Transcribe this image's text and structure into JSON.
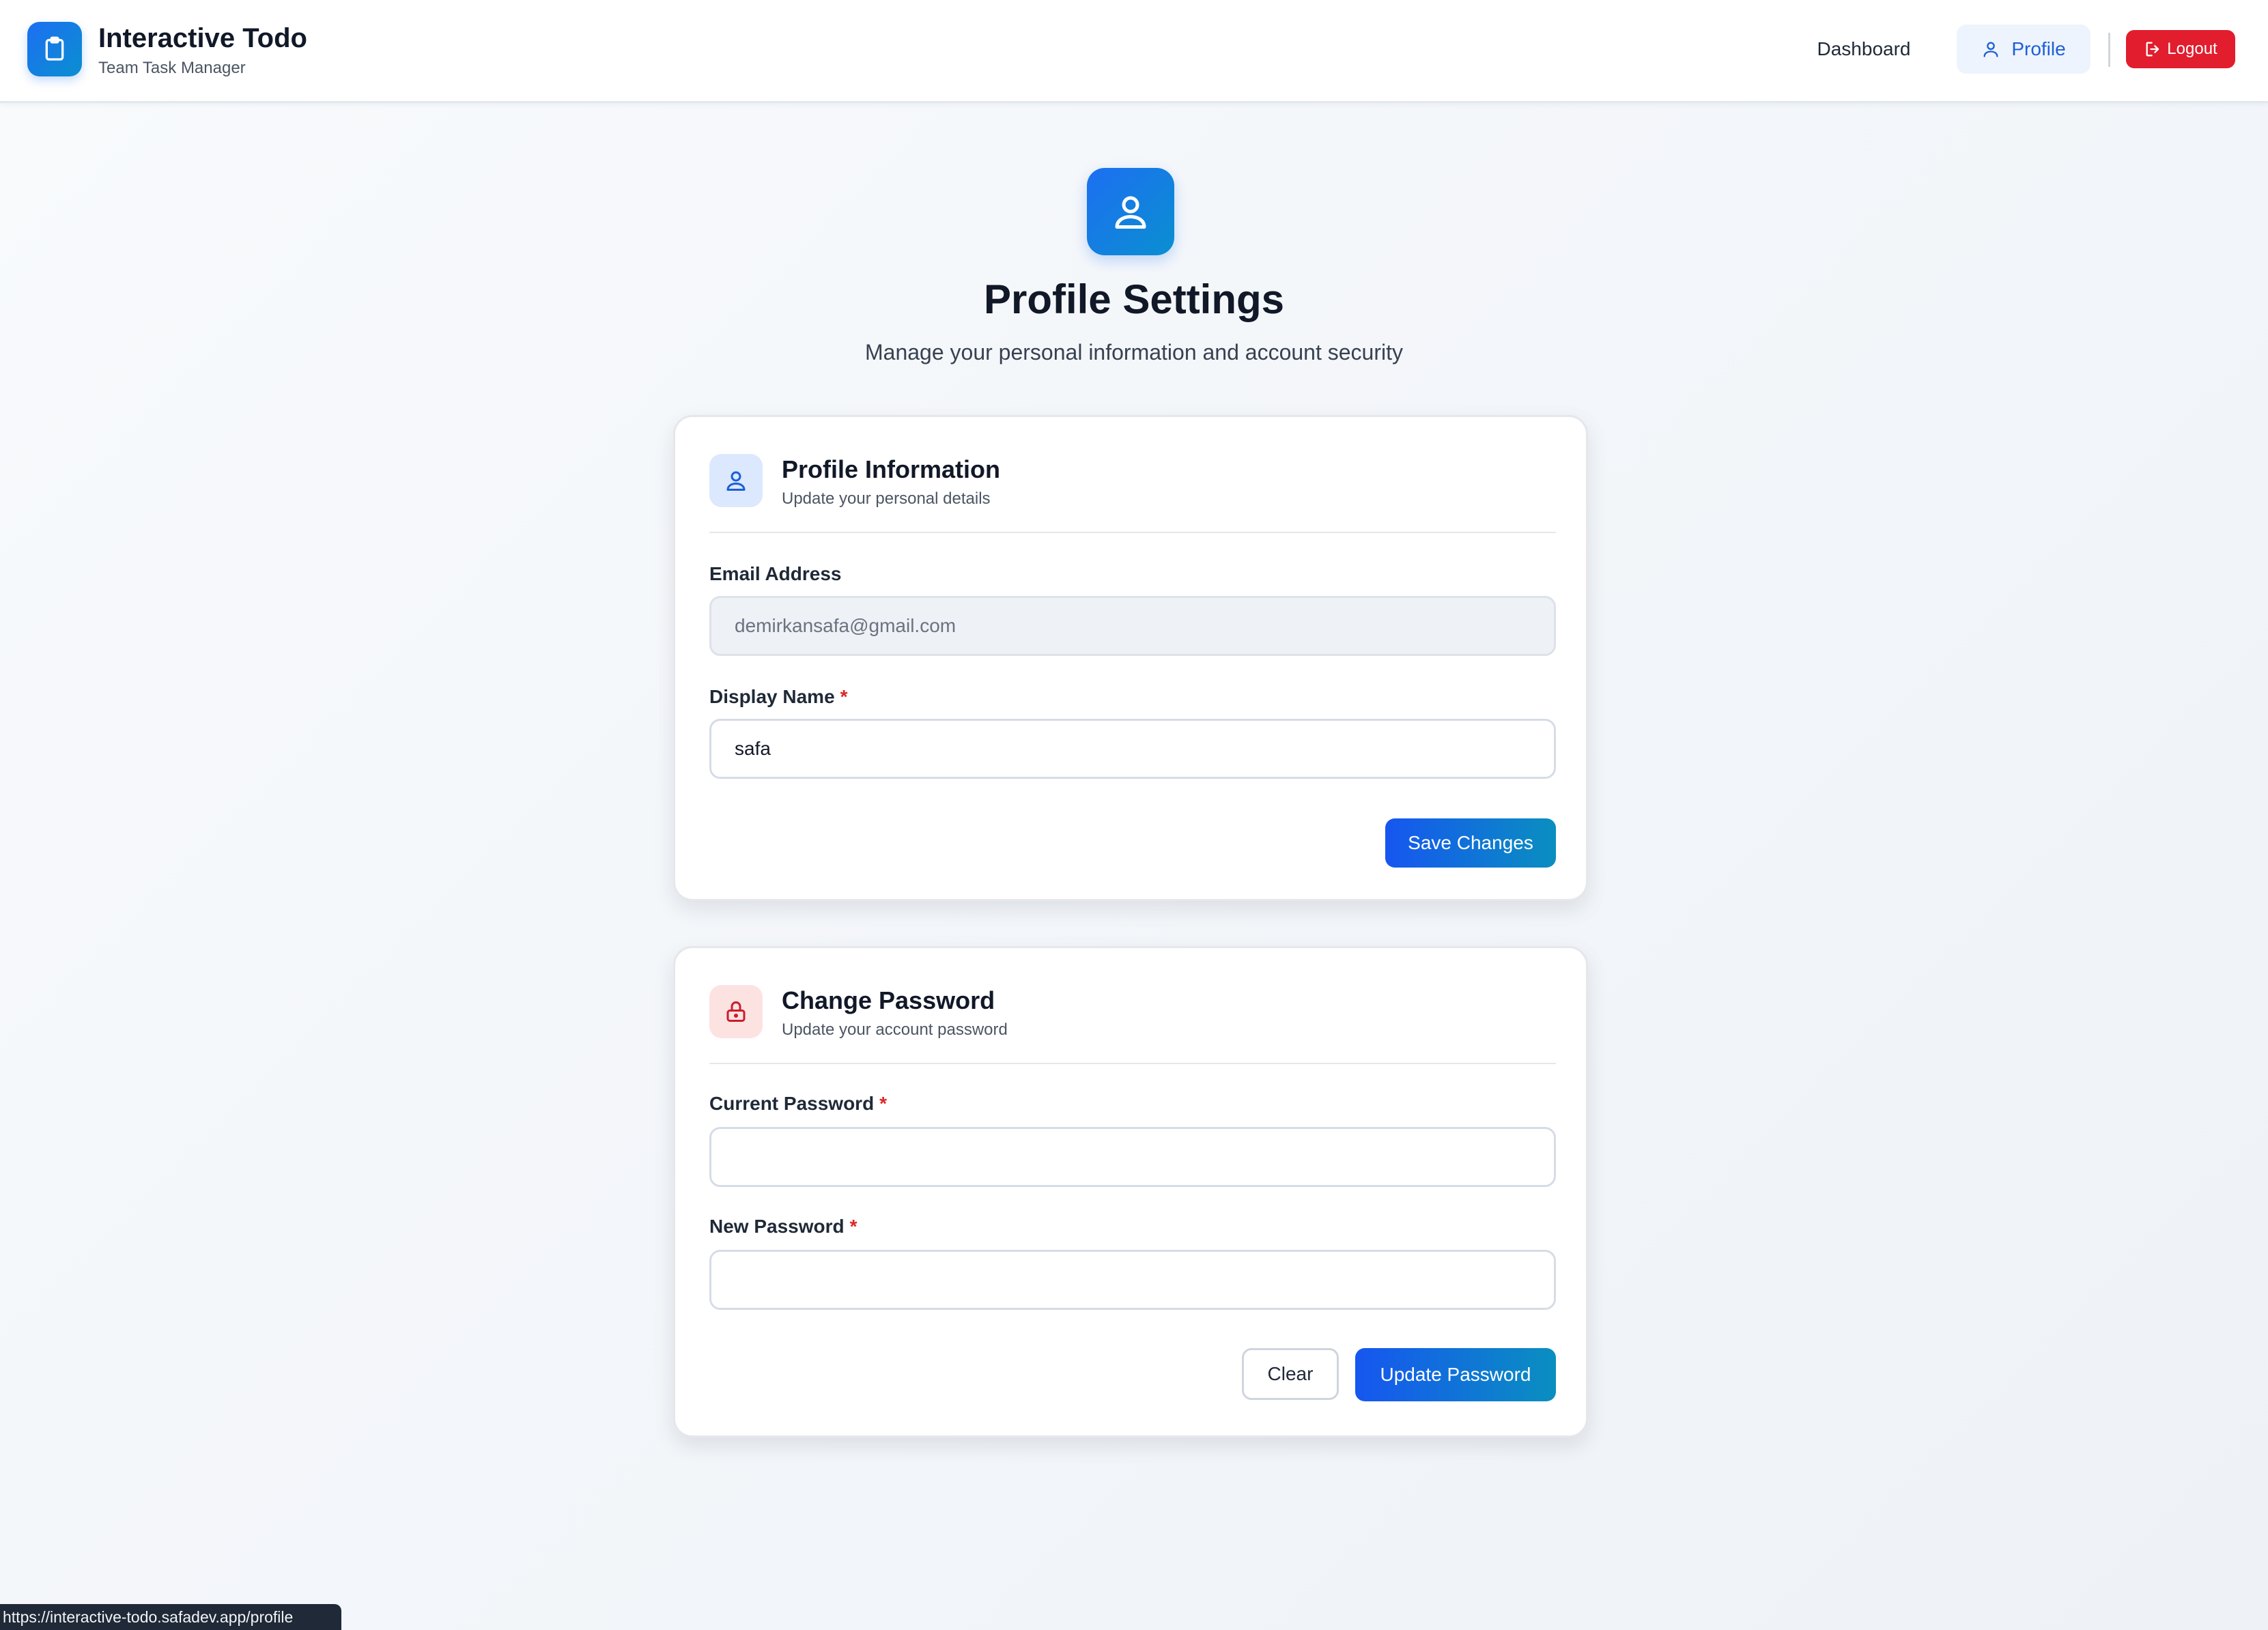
{
  "header": {
    "app_title": "Interactive Todo",
    "app_subtitle": "Team Task Manager",
    "logo_icon": "clipboard-icon",
    "nav": {
      "dashboard_label": "Dashboard",
      "profile_label": "Profile",
      "logout_label": "Logout"
    }
  },
  "hero": {
    "icon": "user-icon",
    "title": "Profile Settings",
    "subtitle": "Manage your personal information and account security"
  },
  "profile_card": {
    "icon": "user-icon",
    "title": "Profile Information",
    "subtitle": "Update your personal details",
    "email_label": "Email Address",
    "email_value": "demirkansafa@gmail.com",
    "display_name_label": "Display Name",
    "display_name_value": "safa",
    "required_marker": "*",
    "save_label": "Save Changes"
  },
  "password_card": {
    "icon": "lock-icon",
    "title": "Change Password",
    "subtitle": "Update your account password",
    "current_password_label": "Current Password",
    "new_password_label": "New Password",
    "required_marker": "*",
    "clear_label": "Clear",
    "update_label": "Update Password"
  },
  "status_bar": {
    "url": "https://interactive-todo.safadev.app/profile"
  },
  "colors": {
    "accent": "#1d6ff2",
    "danger": "#e11d2e",
    "required": "#dc2626"
  }
}
